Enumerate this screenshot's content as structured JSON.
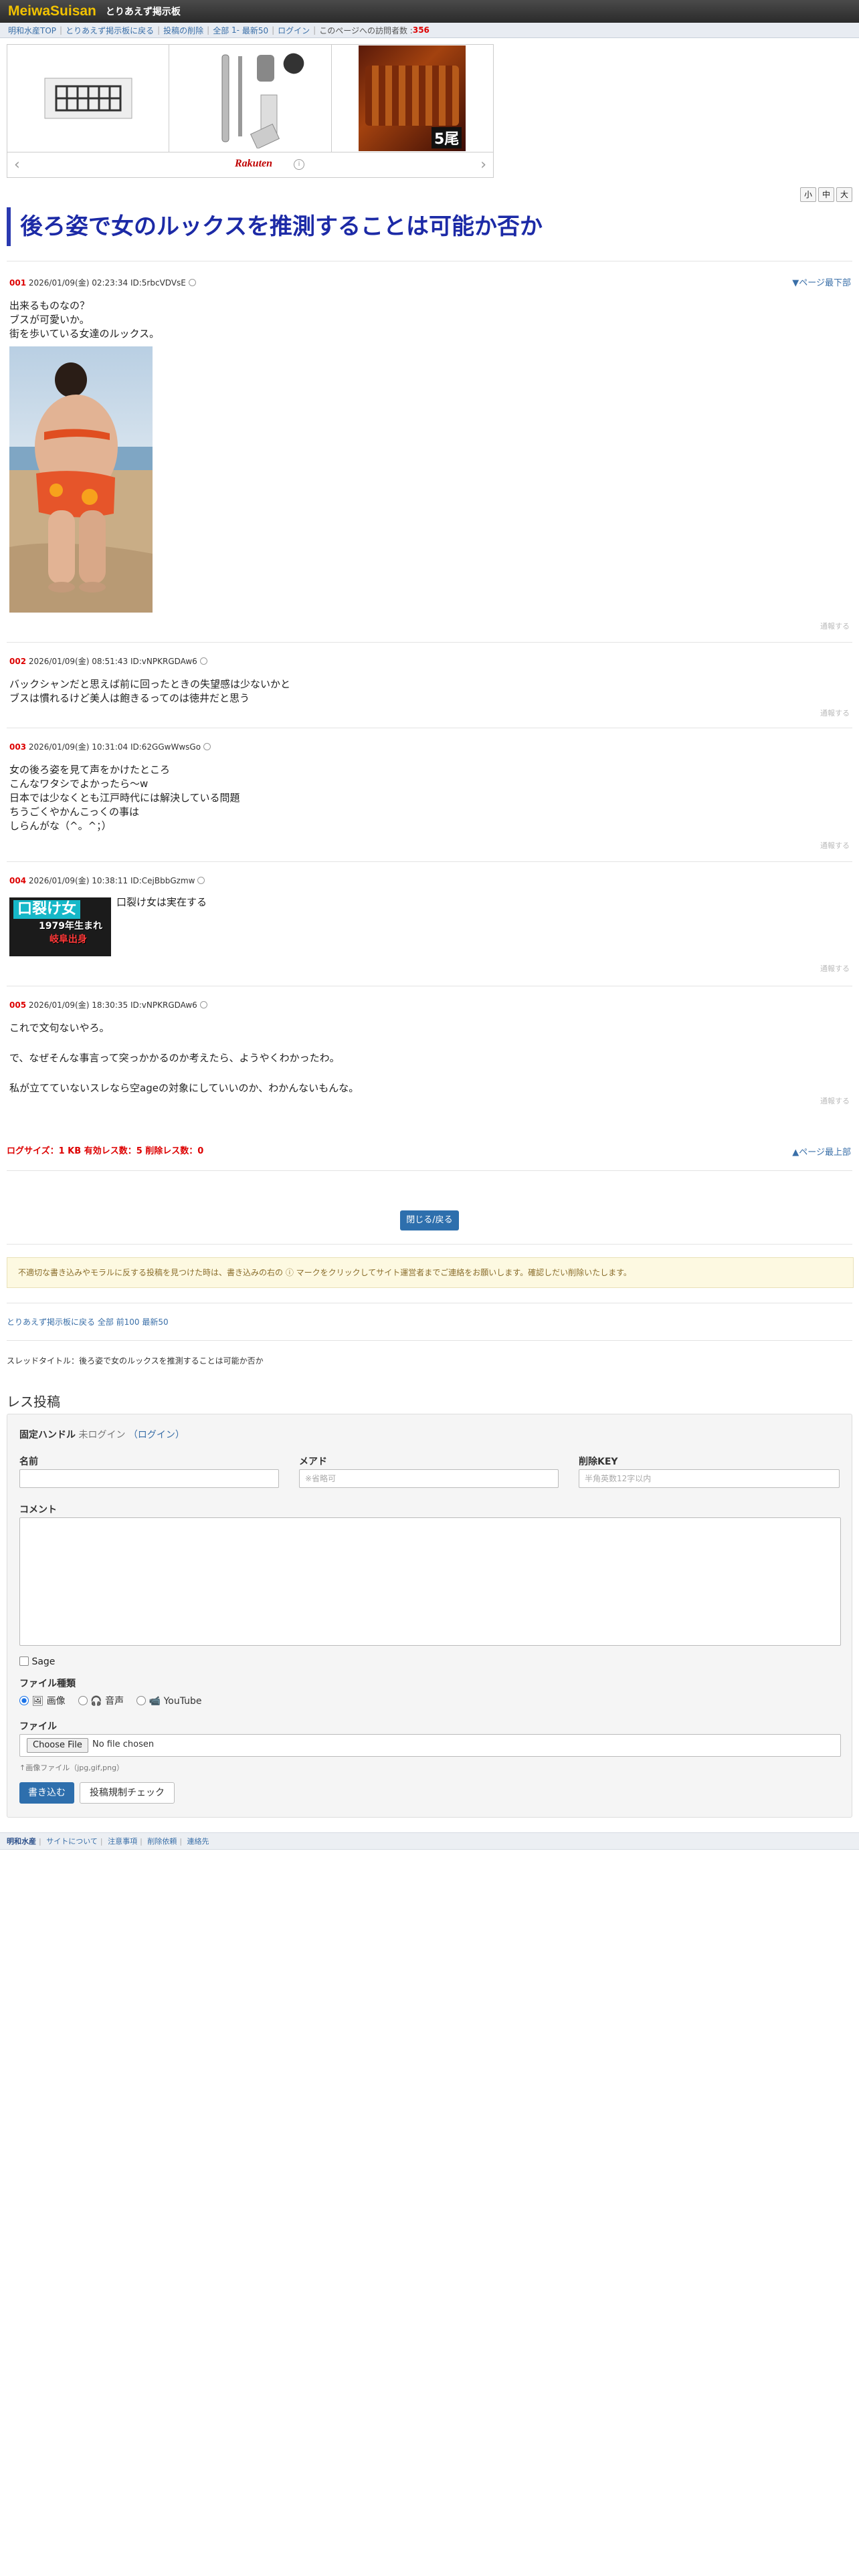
{
  "header": {
    "logo": "MeiwaSuisan",
    "board_name": "とりあえず掲示板"
  },
  "nav": {
    "items": [
      "明和水産TOP",
      "とりあえず掲示板に戻る",
      "投稿の削除",
      "全部",
      "1-",
      "最新50",
      "ログイン"
    ],
    "counter_label": "このページへの訪問者数 :",
    "counter_value": "356"
  },
  "ad": {
    "brand": "Rakuten",
    "items": [
      "ice-tray-product",
      "razor-product",
      "unagi-product"
    ],
    "badge": "5尾"
  },
  "font_size_buttons": [
    "小",
    "中",
    "大"
  ],
  "thread": {
    "title": "後ろ姿で女のルックスを推測することは可能か否か",
    "jump_bottom": "▼ページ最下部",
    "jump_top": "▲ページ最上部",
    "report_label": "通報する",
    "posts": [
      {
        "num": "001",
        "date": "2026/01/09(金) 02:23:34",
        "id": "ID:5rbcVDVsE",
        "lines": [
          "出来るものなの？",
          "ブスが可愛いか。",
          "街を歩いている女達のルックス。"
        ]
      },
      {
        "num": "002",
        "date": "2026/01/09(金) 08:51:43",
        "id": "ID:vNPKRGDAw6",
        "lines": [
          "バックシャンだと思えば前に回ったときの失望感は少ないかと",
          "ブスは慣れるけど美人は飽きるってのは徳井だと思う"
        ]
      },
      {
        "num": "003",
        "date": "2026/01/09(金) 10:31:04",
        "id": "ID:62GGwWwsGo",
        "lines": [
          "女の後ろ姿を見て声をかけたところ",
          "こんなワタシでよかったら〜w",
          "日本では少なくとも江戸時代には解決している問題",
          "ちうごくやかんこっくの事は",
          "しらんがな（^。^；）"
        ]
      },
      {
        "num": "004",
        "date": "2026/01/09(金) 10:38:11",
        "id": "ID:CejBbbGzmw",
        "lines": [
          "口裂け女は実在する"
        ]
      },
      {
        "num": "005",
        "date": "2026/01/09(金) 18:30:35",
        "id": "ID:vNPKRGDAw6",
        "lines": [
          "これで文句ないやろ。",
          "",
          "で、なぜそんな事言って突っかかるのか考えたら、ようやくわかったわ。",
          "",
          "私が立てていないスレなら空ageの対象にしていいのか、わかんないもんな。"
        ]
      }
    ],
    "thumb": {
      "title": "口裂け女",
      "sub": "1979年生まれ",
      "sub2": "岐阜出身"
    },
    "stats": "ログサイズ：1 KB 有効レス数：5 削除レス数：0",
    "close_button": "閉じる/戻る",
    "notice": "不適切な書き込みやモラルに反する投稿を見つけた時は、書き込みの右の ⓘ マークをクリックしてサイト運営者までご連絡をお願いします。確認しだい削除いたします。",
    "sublinks": "とりあえず掲示板に戻る 全部 前100 最新50",
    "thread_label": "スレッドタイトル：後ろ姿で女のルックスを推測することは可能か否か"
  },
  "form": {
    "title": "レス投稿",
    "handle_label": "固定ハンドル",
    "handle_state": "未ログイン",
    "login_link": "（ログイン）",
    "name_label": "名前",
    "mail_label": "メアド",
    "mail_placeholder": "※省略可",
    "delkey_label": "削除KEY",
    "delkey_placeholder": "半角英数12字以内",
    "comment_label": "コメント",
    "sage_label": "Sage",
    "filetype_label": "ファイル種類",
    "filetypes": [
      "画像",
      "音声",
      "YouTube"
    ],
    "file_label": "ファイル",
    "file_button": "Choose File",
    "file_none": "No file chosen",
    "file_hint": "↑画像ファイル（jpg,gif,png）",
    "submit": "書き込む",
    "check": "投稿規制チェック"
  },
  "footer": {
    "items": [
      "明和水産",
      "サイトについて",
      "注意事項",
      "削除依頼",
      "連絡先"
    ]
  }
}
